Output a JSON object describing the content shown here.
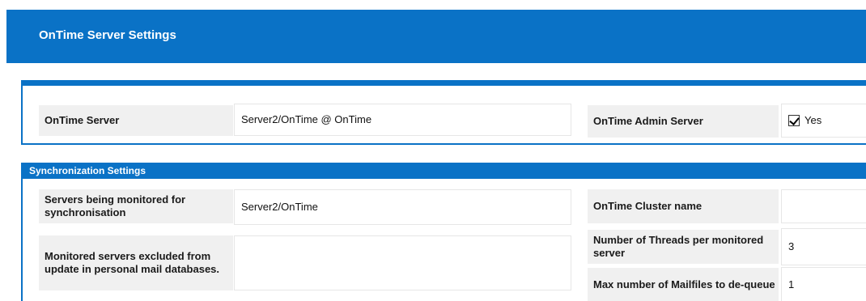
{
  "page": {
    "title": "OnTime Server Settings"
  },
  "server_panel": {
    "ontime_server_label": "OnTime Server",
    "ontime_server_value": "Server2/OnTime @ OnTime",
    "admin_server_label": "OnTime Admin Server",
    "admin_server_checked": true,
    "admin_server_option": "Yes"
  },
  "sync_panel": {
    "header": "Synchronization Settings",
    "servers_monitored_label": "Servers being monitored for synchronisation",
    "servers_monitored_value": "Server2/OnTime",
    "excluded_label": "Monitored servers excluded from update in personal mail databases.",
    "excluded_value": "",
    "cluster_label": "OnTime Cluster name",
    "cluster_value": "",
    "threads_label": "Number of Threads per monitored server",
    "threads_value": "3",
    "dequeue_label": "Max number of Mailfiles to de-queue",
    "dequeue_value": "1"
  }
}
